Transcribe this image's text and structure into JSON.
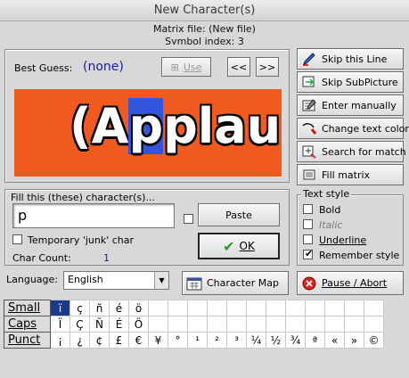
{
  "window": {
    "title": "New Character(s)"
  },
  "info": {
    "matrix_file": "Matrix file: (New file)",
    "symbol_index": "Symbol index: 3"
  },
  "guess": {
    "label": "Best Guess:",
    "value": "(none)",
    "use_label": "Use",
    "prev_label": "<<",
    "next_label": ">>"
  },
  "preview": {
    "text_before": "(A",
    "highlight": "p",
    "text_after": "plaus",
    "bg_color": "#f05a1e",
    "highlight_color": "#3355dd"
  },
  "fill": {
    "group_label": "Fill this (these) character(s)...",
    "input_value": "p",
    "paste_label": "Paste",
    "temporary_label": "Temporary 'junk' char",
    "ok_label": "OK",
    "char_count_label": "Char Count:",
    "char_count_value": "1"
  },
  "actions": [
    {
      "label": "Skip this Line",
      "icon": "pen-icon"
    },
    {
      "label": "Skip SubPicture",
      "icon": "skip-icon"
    },
    {
      "label": "Enter manually",
      "icon": "keyboard-icon"
    },
    {
      "label": "Change text color",
      "icon": "color-icon"
    },
    {
      "label": "Search for match",
      "icon": "search-icon"
    },
    {
      "label": "Fill matrix",
      "icon": "matrix-icon"
    }
  ],
  "text_style": {
    "group_label": "Text style",
    "bold": "Bold",
    "italic": "Italic",
    "underline": "Underline",
    "remember": "Remember style",
    "remember_checked": true
  },
  "language": {
    "label": "Language:",
    "value": "English"
  },
  "bottom": {
    "char_map_label": "Character Map",
    "pause_label": "Pause / Abort"
  },
  "char_table": {
    "rows": [
      {
        "name": "Small",
        "chars": [
          "ï",
          "ç",
          "ñ",
          "é",
          "ö",
          "",
          "",
          "",
          "",
          "",
          "",
          "",
          "",
          "",
          "",
          "",
          ""
        ]
      },
      {
        "name": "Caps",
        "chars": [
          "Ï",
          "Ç",
          "Ñ",
          "É",
          "Ö",
          "",
          "",
          "",
          "",
          "",
          "",
          "",
          "",
          "",
          "",
          "",
          ""
        ]
      },
      {
        "name": "Punct",
        "chars": [
          "¡",
          "¿",
          "¢",
          "£",
          "€",
          "¥",
          "°",
          "¹",
          "²",
          "³",
          "¼",
          "½",
          "¾",
          "ª",
          "«",
          "»",
          "©"
        ]
      }
    ]
  }
}
